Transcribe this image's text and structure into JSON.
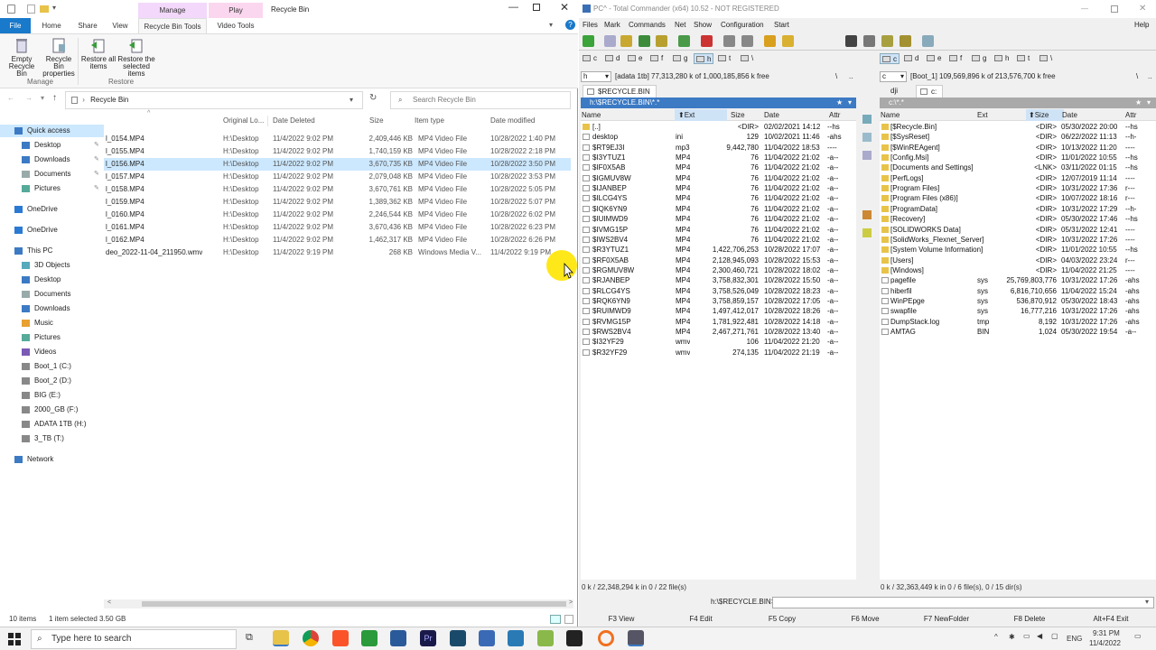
{
  "explorer": {
    "title": "Recycle Bin",
    "context_tabs": {
      "manage": "Manage",
      "play": "Play"
    },
    "tabs": [
      "File",
      "Home",
      "Share",
      "View",
      "Recycle Bin Tools",
      "Video Tools"
    ],
    "ribbon": {
      "empty": "Empty Recycle Bin",
      "props": "Recycle Bin properties",
      "restore_all": "Restore all items",
      "restore_sel": "Restore the selected items",
      "group_manage": "Manage",
      "group_restore": "Restore"
    },
    "address": "Recycle Bin",
    "search_placeholder": "Search Recycle Bin",
    "nav": [
      {
        "label": "Quick access",
        "icon": "star-icon",
        "pin": false,
        "sel": true
      },
      {
        "label": "Desktop",
        "icon": "desktop-icon",
        "pin": true
      },
      {
        "label": "Downloads",
        "icon": "download-icon",
        "pin": true
      },
      {
        "label": "Documents",
        "icon": "document-icon",
        "pin": true
      },
      {
        "label": "Pictures",
        "icon": "picture-icon",
        "pin": true
      },
      {
        "label": "OneDrive",
        "icon": "cloud-icon",
        "gap": true
      },
      {
        "label": "OneDrive",
        "icon": "cloud-icon",
        "gap": true
      },
      {
        "label": "This PC",
        "icon": "computer-icon",
        "gap": true
      },
      {
        "label": "3D Objects",
        "icon": "cube-icon"
      },
      {
        "label": "Desktop",
        "icon": "desktop-icon"
      },
      {
        "label": "Documents",
        "icon": "document-icon"
      },
      {
        "label": "Downloads",
        "icon": "download-icon"
      },
      {
        "label": "Music",
        "icon": "music-icon"
      },
      {
        "label": "Pictures",
        "icon": "picture-icon"
      },
      {
        "label": "Videos",
        "icon": "video-icon"
      },
      {
        "label": "Boot_1 (C:)",
        "icon": "drive-icon"
      },
      {
        "label": "Boot_2 (D:)",
        "icon": "drive-icon"
      },
      {
        "label": "BIG (E:)",
        "icon": "drive-icon"
      },
      {
        "label": "2000_GB (F:)",
        "icon": "drive-icon"
      },
      {
        "label": "ADATA 1TB (H:)",
        "icon": "drive-icon"
      },
      {
        "label": "3_TB (T:)",
        "icon": "drive-icon"
      },
      {
        "label": "Network",
        "icon": "network-icon",
        "gap": true
      }
    ],
    "columns": [
      "Original Lo...",
      "Date Deleted",
      "Size",
      "Item type",
      "Date modified"
    ],
    "files": [
      {
        "name": "l_0154.MP4",
        "loc": "H:\\Desktop",
        "deleted": "11/4/2022 9:02 PM",
        "size": "2,409,446 KB",
        "type": "MP4 Video File",
        "modified": "10/28/2022 1:40 PM"
      },
      {
        "name": "l_0155.MP4",
        "loc": "H:\\Desktop",
        "deleted": "11/4/2022 9:02 PM",
        "size": "1,740,159 KB",
        "type": "MP4 Video File",
        "modified": "10/28/2022 2:18 PM"
      },
      {
        "name": "l_0156.MP4",
        "loc": "H:\\Desktop",
        "deleted": "11/4/2022 9:02 PM",
        "size": "3,670,735 KB",
        "type": "MP4 Video File",
        "modified": "10/28/2022 3:50 PM",
        "sel": true
      },
      {
        "name": "l_0157.MP4",
        "loc": "H:\\Desktop",
        "deleted": "11/4/2022 9:02 PM",
        "size": "2,079,048 KB",
        "type": "MP4 Video File",
        "modified": "10/28/2022 3:53 PM"
      },
      {
        "name": "l_0158.MP4",
        "loc": "H:\\Desktop",
        "deleted": "11/4/2022 9:02 PM",
        "size": "3,670,761 KB",
        "type": "MP4 Video File",
        "modified": "10/28/2022 5:05 PM"
      },
      {
        "name": "l_0159.MP4",
        "loc": "H:\\Desktop",
        "deleted": "11/4/2022 9:02 PM",
        "size": "1,389,362 KB",
        "type": "MP4 Video File",
        "modified": "10/28/2022 5:07 PM"
      },
      {
        "name": "l_0160.MP4",
        "loc": "H:\\Desktop",
        "deleted": "11/4/2022 9:02 PM",
        "size": "2,246,544 KB",
        "type": "MP4 Video File",
        "modified": "10/28/2022 6:02 PM"
      },
      {
        "name": "l_0161.MP4",
        "loc": "H:\\Desktop",
        "deleted": "11/4/2022 9:02 PM",
        "size": "3,670,436 KB",
        "type": "MP4 Video File",
        "modified": "10/28/2022 6:23 PM"
      },
      {
        "name": "l_0162.MP4",
        "loc": "H:\\Desktop",
        "deleted": "11/4/2022 9:02 PM",
        "size": "1,462,317 KB",
        "type": "MP4 Video File",
        "modified": "10/28/2022 6:26 PM"
      },
      {
        "name": "deo_2022-11-04_211950.wmv",
        "loc": "H:\\Desktop",
        "deleted": "11/4/2022 9:19 PM",
        "size": "268 KB",
        "type": "Windows Media V...",
        "modified": "11/4/2022 9:19 PM"
      }
    ],
    "status_items": "10 items",
    "status_sel": "1 item selected  3.50 GB"
  },
  "tc": {
    "title": "PC^ - Total Commander (x64) 10.52 - NOT REGISTERED",
    "menu": [
      "Files",
      "Mark",
      "Commands",
      "Net",
      "Show",
      "Configuration",
      "Start"
    ],
    "help": "Help",
    "drives": [
      "c",
      "d",
      "e",
      "f",
      "g",
      "h",
      "t",
      "\\"
    ],
    "left": {
      "drive_sel": "h",
      "info": "[adata 1tb]  77,313,280 k of 1,000,185,856 k free",
      "tab": "$RECYCLE.BIN",
      "path": "h:\\$RECYCLE.BIN\\*.*",
      "cols": [
        "Name",
        "Ext",
        "Size",
        "Date",
        "Attr"
      ],
      "rows": [
        [
          "[..]",
          "",
          "<DIR>",
          "02/02/2021 14:12",
          "--hs"
        ],
        [
          "desktop",
          "ini",
          "129",
          "10/02/2021 11:46",
          "-ahs"
        ],
        [
          "$RT9EJ3I",
          "mp3",
          "9,442,780",
          "11/04/2022 18:53",
          "----"
        ],
        [
          "$I3YTUZ1",
          "MP4",
          "76",
          "11/04/2022 21:02",
          "-a--"
        ],
        [
          "$IF0X5AB",
          "MP4",
          "76",
          "11/04/2022 21:02",
          "-a--"
        ],
        [
          "$IGMUV8W",
          "MP4",
          "76",
          "11/04/2022 21:02",
          "-a--"
        ],
        [
          "$IJANBEP",
          "MP4",
          "76",
          "11/04/2022 21:02",
          "-a--"
        ],
        [
          "$ILCG4YS",
          "MP4",
          "76",
          "11/04/2022 21:02",
          "-a--"
        ],
        [
          "$IQK6YN9",
          "MP4",
          "76",
          "11/04/2022 21:02",
          "-a--"
        ],
        [
          "$IUIMWD9",
          "MP4",
          "76",
          "11/04/2022 21:02",
          "-a--"
        ],
        [
          "$IVMG15P",
          "MP4",
          "76",
          "11/04/2022 21:02",
          "-a--"
        ],
        [
          "$IWS2BV4",
          "MP4",
          "76",
          "11/04/2022 21:02",
          "-a--"
        ],
        [
          "$R3YTUZ1",
          "MP4",
          "1,422,706,253",
          "10/28/2022 17:07",
          "-a--"
        ],
        [
          "$RF0X5AB",
          "MP4",
          "2,128,945,093",
          "10/28/2022 15:53",
          "-a--"
        ],
        [
          "$RGMUV8W",
          "MP4",
          "2,300,460,721",
          "10/28/2022 18:02",
          "-a--"
        ],
        [
          "$RJANBEP",
          "MP4",
          "3,758,832,301",
          "10/28/2022 15:50",
          "-a--"
        ],
        [
          "$RLCG4YS",
          "MP4",
          "3,758,526,049",
          "10/28/2022 18:23",
          "-a--"
        ],
        [
          "$RQK6YN9",
          "MP4",
          "3,758,859,157",
          "10/28/2022 17:05",
          "-a--"
        ],
        [
          "$RUIMWD9",
          "MP4",
          "1,497,412,017",
          "10/28/2022 18:26",
          "-a--"
        ],
        [
          "$RVMG15P",
          "MP4",
          "1,781,922,481",
          "10/28/2022 14:18",
          "-a--"
        ],
        [
          "$RWS2BV4",
          "MP4",
          "2,467,271,761",
          "10/28/2022 13:40",
          "-a--"
        ],
        [
          "$I32YF29",
          "wmv",
          "106",
          "11/04/2022 21:20",
          "-a--"
        ],
        [
          "$R32YF29",
          "wmv",
          "274,135",
          "11/04/2022 21:19",
          "-a--"
        ]
      ],
      "status": "0 k / 22,348,294 k in 0 / 22 file(s)"
    },
    "right": {
      "drive_sel": "c",
      "info": "[Boot_1]  109,569,896 k of 213,576,700 k free",
      "tab_a": "dji",
      "tab_b": "c:",
      "path": "c:\\*.*",
      "cols": [
        "Name",
        "Ext",
        "Size",
        "Date",
        "Attr"
      ],
      "rows": [
        [
          "[$Recycle.Bin]",
          "",
          "<DIR>",
          "05/30/2022 20:00",
          "--hs"
        ],
        [
          "[$SysReset]",
          "",
          "<DIR>",
          "06/22/2022 11:13",
          "--h-"
        ],
        [
          "[$WinREAgent]",
          "",
          "<DIR>",
          "10/13/2022 11:20",
          "----"
        ],
        [
          "[Config.Msi]",
          "",
          "<DIR>",
          "11/01/2022 10:55",
          "--hs"
        ],
        [
          "[Documents and Settings]",
          "",
          "<LNK>",
          "03/11/2022 01:15",
          "--hs"
        ],
        [
          "[PerfLogs]",
          "",
          "<DIR>",
          "12/07/2019 11:14",
          "----"
        ],
        [
          "[Program Files]",
          "",
          "<DIR>",
          "10/31/2022 17:36",
          "r---"
        ],
        [
          "[Program Files (x86)]",
          "",
          "<DIR>",
          "10/07/2022 18:16",
          "r---"
        ],
        [
          "[ProgramData]",
          "",
          "<DIR>",
          "10/31/2022 17:29",
          "--h-"
        ],
        [
          "[Recovery]",
          "",
          "<DIR>",
          "05/30/2022 17:46",
          "--hs"
        ],
        [
          "[SOLIDWORKS Data]",
          "",
          "<DIR>",
          "05/31/2022 12:41",
          "----"
        ],
        [
          "[SolidWorks_Flexnet_Server]",
          "",
          "<DIR>",
          "10/31/2022 17:26",
          "----"
        ],
        [
          "[System Volume Information]",
          "",
          "<DIR>",
          "11/01/2022 10:55",
          "--hs"
        ],
        [
          "[Users]",
          "",
          "<DIR>",
          "04/03/2022 23:24",
          "r---"
        ],
        [
          "[Windows]",
          "",
          "<DIR>",
          "11/04/2022 21:25",
          "----"
        ],
        [
          "pagefile",
          "sys",
          "25,769,803,776",
          "10/31/2022 17:26",
          "-ahs"
        ],
        [
          "hiberfil",
          "sys",
          "6,816,710,656",
          "11/04/2022 15:24",
          "-ahs"
        ],
        [
          "WinPEpge",
          "sys",
          "536,870,912",
          "05/30/2022 18:43",
          "-ahs"
        ],
        [
          "swapfile",
          "sys",
          "16,777,216",
          "10/31/2022 17:26",
          "-ahs"
        ],
        [
          "DumpStack.log",
          "tmp",
          "8,192",
          "10/31/2022 17:26",
          "-ahs"
        ],
        [
          "AMTAG",
          "BIN",
          "1,024",
          "05/30/2022 19:54",
          "-a--"
        ]
      ],
      "status": "0 k / 32,363,449 k in 0 / 6 file(s), 0 / 15 dir(s)"
    },
    "cmd_prompt": "h:\\$RECYCLE.BIN>",
    "fkeys": [
      "F3 View",
      "F4 Edit",
      "F5 Copy",
      "F6 Move",
      "F7 NewFolder",
      "F8 Delete",
      "Alt+F4 Exit"
    ]
  },
  "taskbar": {
    "search_placeholder": "Type here to search",
    "lang": "ENG",
    "time": "9:31 PM",
    "date": "11/4/2022"
  },
  "colors": {
    "tc_path_active": "#3c7ac4",
    "tc_path_inactive": "#a9a9a9",
    "selection": "#cce8ff",
    "manage_tab": "#f3d8fb",
    "play_tab": "#fbd7ef",
    "cursor_highlight": "#ffe600"
  }
}
